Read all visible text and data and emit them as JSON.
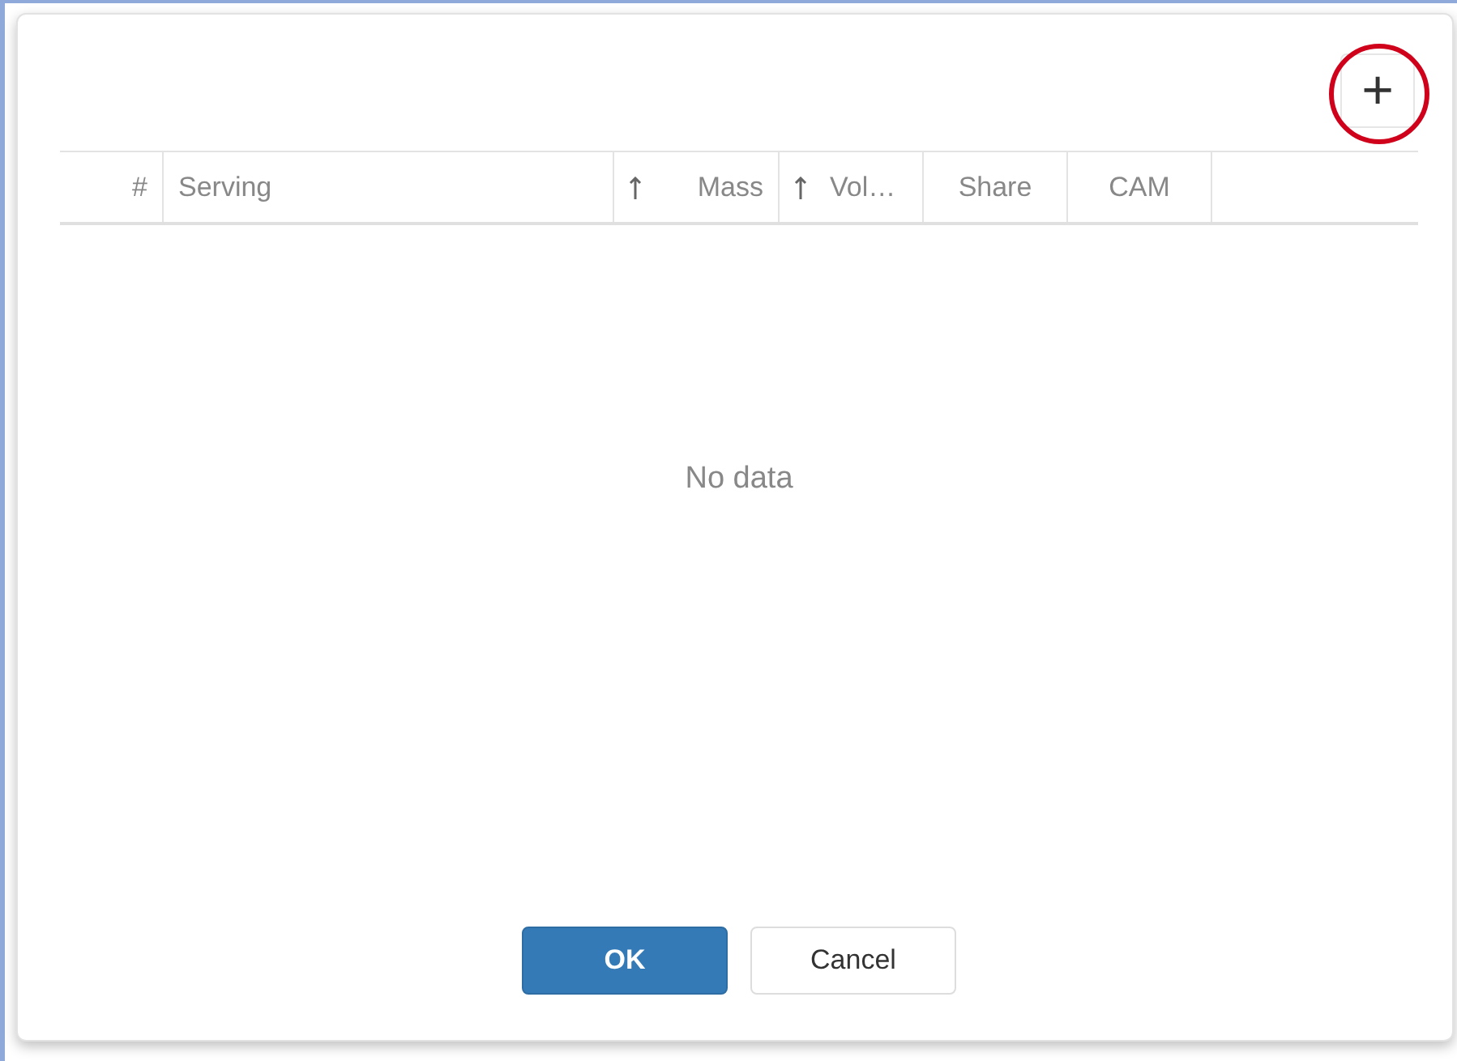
{
  "dialog": {
    "add_button": {
      "label": "+",
      "highlighted": true
    },
    "table": {
      "columns": [
        {
          "label": "#",
          "sorted": false
        },
        {
          "label": "Serving",
          "sorted": false
        },
        {
          "label": "Mass",
          "sorted": true
        },
        {
          "label": "Vol…",
          "sorted": true
        },
        {
          "label": "Share",
          "sorted": false
        },
        {
          "label": "CAM",
          "sorted": false
        }
      ],
      "empty_text": "No data"
    },
    "buttons": [
      {
        "label": "OK",
        "kind": "primary"
      },
      {
        "label": "Cancel",
        "kind": "default"
      }
    ]
  }
}
